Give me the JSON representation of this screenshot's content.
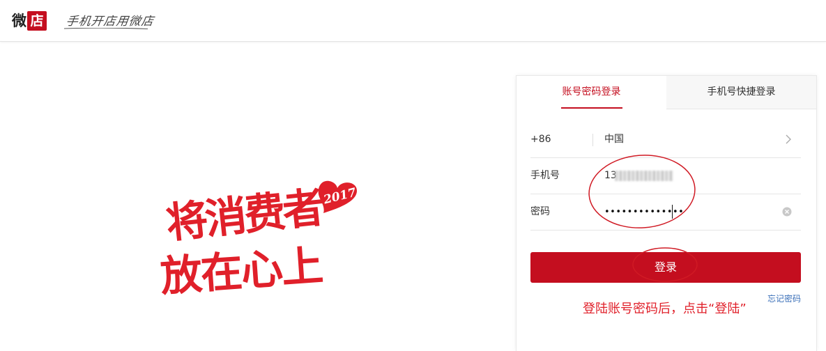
{
  "header": {
    "logo_part1": "微",
    "logo_part2": "店",
    "slogan": "手机开店用微店"
  },
  "artwork": {
    "line1": "将消费者",
    "line2": "放在心上",
    "year": "2017"
  },
  "login": {
    "tabs": [
      "账号密码登录",
      "手机号快捷登录"
    ],
    "active_tab": 0,
    "country_code": "+86",
    "country_name": "中国",
    "phone_label": "手机号",
    "phone_value_visible": "13",
    "password_label": "密码",
    "password_masked": "••••••••••••••",
    "submit_label": "登录",
    "forgot_label": "忘记密码"
  },
  "annotation": {
    "text": "登陆账号密码后，点击“登陆”"
  },
  "colors": {
    "brand_red": "#c40e1f",
    "art_red": "#e0202a",
    "link_blue": "#3a6fb8"
  }
}
